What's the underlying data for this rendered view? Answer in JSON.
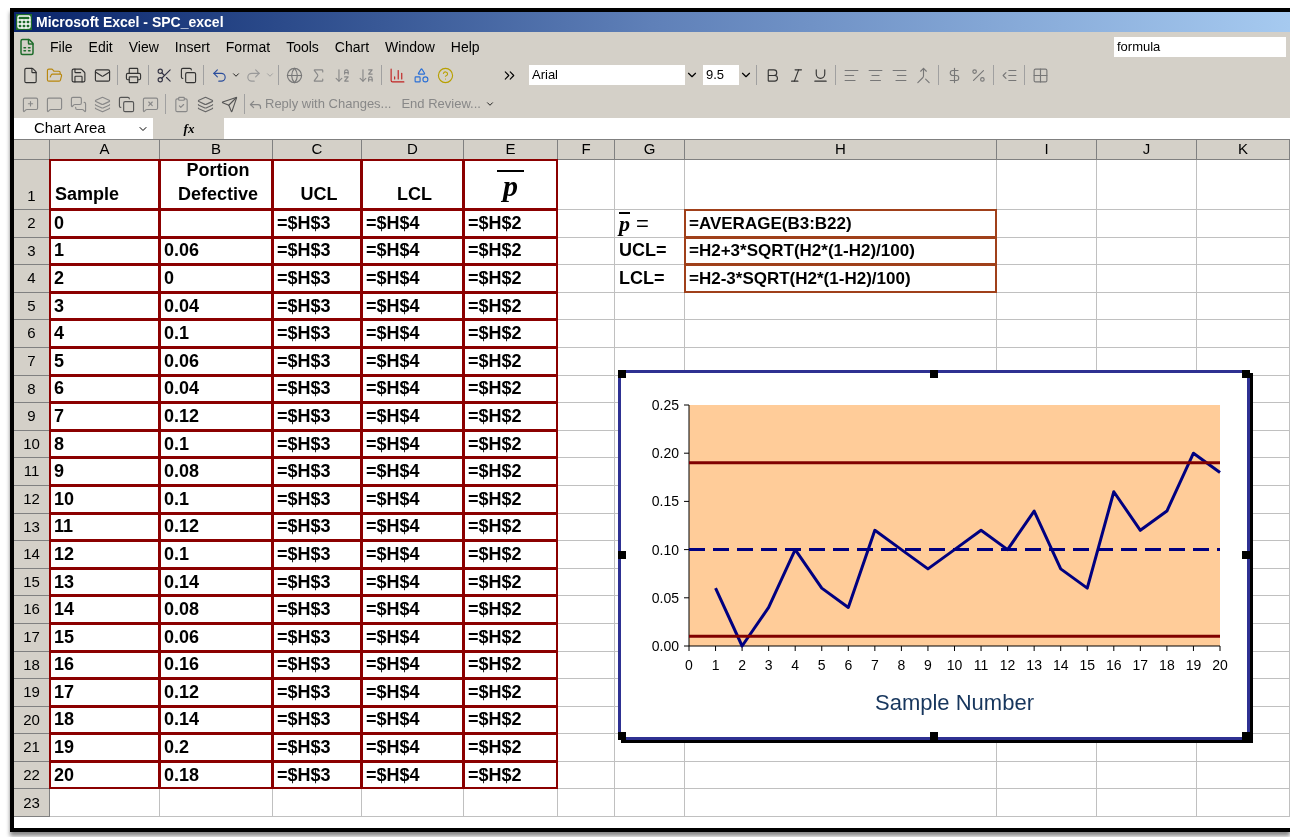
{
  "window": {
    "title": "Microsoft Excel - SPC_excel"
  },
  "menu": [
    {
      "label": "File"
    },
    {
      "label": "Edit"
    },
    {
      "label": "View"
    },
    {
      "label": "Insert"
    },
    {
      "label": "Format"
    },
    {
      "label": "Tools"
    },
    {
      "label": "Chart"
    },
    {
      "label": "Window"
    },
    {
      "label": "Help"
    }
  ],
  "help_box": {
    "value": "formula"
  },
  "font_box": {
    "name": "Arial",
    "size": "9.5"
  },
  "review_toolbar": [
    "Reply with Changes...",
    "End Review..."
  ],
  "name_box": {
    "value": "Chart Area"
  },
  "formula_label": "fx",
  "columns": [
    "A",
    "B",
    "C",
    "D",
    "E",
    "F",
    "G",
    "H",
    "I",
    "J",
    "K"
  ],
  "header_row": {
    "number": "1",
    "cells": [
      "Sample",
      "Portion Defective",
      "UCL",
      "LCL"
    ],
    "pbar_symbol": "p"
  },
  "rows": [
    {
      "number": "2",
      "sample": "0",
      "ucl": "=$H$3",
      "lcl": "=$H$4",
      "pbar": "=$H$2"
    },
    {
      "number": "3",
      "sample": "1",
      "portion": "0.06",
      "ucl": "=$H$3",
      "lcl": "=$H$4",
      "pbar": "=$H$2"
    },
    {
      "number": "4",
      "sample": "2",
      "portion": "0",
      "ucl": "=$H$3",
      "lcl": "=$H$4",
      "pbar": "=$H$2"
    },
    {
      "number": "5",
      "sample": "3",
      "portion": "0.04",
      "ucl": "=$H$3",
      "lcl": "=$H$4",
      "pbar": "=$H$2"
    },
    {
      "number": "6",
      "sample": "4",
      "portion": "0.1",
      "ucl": "=$H$3",
      "lcl": "=$H$4",
      "pbar": "=$H$2"
    },
    {
      "number": "7",
      "sample": "5",
      "portion": "0.06",
      "ucl": "=$H$3",
      "lcl": "=$H$4",
      "pbar": "=$H$2"
    },
    {
      "number": "8",
      "sample": "6",
      "portion": "0.04",
      "ucl": "=$H$3",
      "lcl": "=$H$4",
      "pbar": "=$H$2"
    },
    {
      "number": "9",
      "sample": "7",
      "portion": "0.12",
      "ucl": "=$H$3",
      "lcl": "=$H$4",
      "pbar": "=$H$2"
    },
    {
      "number": "10",
      "sample": "8",
      "portion": "0.1",
      "ucl": "=$H$3",
      "lcl": "=$H$4",
      "pbar": "=$H$2"
    },
    {
      "number": "11",
      "sample": "9",
      "portion": "0.08",
      "ucl": "=$H$3",
      "lcl": "=$H$4",
      "pbar": "=$H$2"
    },
    {
      "number": "12",
      "sample": "10",
      "portion": "0.1",
      "ucl": "=$H$3",
      "lcl": "=$H$4",
      "pbar": "=$H$2"
    },
    {
      "number": "13",
      "sample": "11",
      "portion": "0.12",
      "ucl": "=$H$3",
      "lcl": "=$H$4",
      "pbar": "=$H$2"
    },
    {
      "number": "14",
      "sample": "12",
      "portion": "0.1",
      "ucl": "=$H$3",
      "lcl": "=$H$4",
      "pbar": "=$H$2"
    },
    {
      "number": "15",
      "sample": "13",
      "portion": "0.14",
      "ucl": "=$H$3",
      "lcl": "=$H$4",
      "pbar": "=$H$2"
    },
    {
      "number": "16",
      "sample": "14",
      "portion": "0.08",
      "ucl": "=$H$3",
      "lcl": "=$H$4",
      "pbar": "=$H$2"
    },
    {
      "number": "17",
      "sample": "15",
      "portion": "0.06",
      "ucl": "=$H$3",
      "lcl": "=$H$4",
      "pbar": "=$H$2"
    },
    {
      "number": "18",
      "sample": "16",
      "portion": "0.16",
      "ucl": "=$H$3",
      "lcl": "=$H$4",
      "pbar": "=$H$2"
    },
    {
      "number": "19",
      "sample": "17",
      "portion": "0.12",
      "ucl": "=$H$3",
      "lcl": "=$H$4",
      "pbar": "=$H$2"
    },
    {
      "number": "20",
      "sample": "18",
      "portion": "0.14",
      "ucl": "=$H$3",
      "lcl": "=$H$4",
      "pbar": "=$H$2"
    },
    {
      "number": "21",
      "sample": "19",
      "portion": "0.2",
      "ucl": "=$H$3",
      "lcl": "=$H$4",
      "pbar": "=$H$2"
    },
    {
      "number": "22",
      "sample": "20",
      "portion": "0.18",
      "ucl": "=$H$3",
      "lcl": "=$H$4",
      "pbar": "=$H$2"
    }
  ],
  "last_row": "23",
  "formulas": [
    {
      "kind": "pbar",
      "symbol": "p",
      "label": "=",
      "formula": "=AVERAGE(B3:B22)"
    },
    {
      "kind": "text",
      "label": "UCL=",
      "formula": "=H2+3*SQRT(H2*(1-H2)/100)"
    },
    {
      "kind": "text",
      "label": "LCL=",
      "formula": "=H2-3*SQRT(H2*(1-H2)/100)"
    }
  ],
  "chart": {
    "selected": true,
    "chart_data": {
      "type": "line",
      "xlabel": "Sample Number",
      "x": [
        0,
        1,
        2,
        3,
        4,
        5,
        6,
        7,
        8,
        9,
        10,
        11,
        12,
        13,
        14,
        15,
        16,
        17,
        18,
        19,
        20
      ],
      "xlim": [
        0,
        20
      ],
      "ylim": [
        0,
        0.25
      ],
      "xticks": [
        0,
        1,
        2,
        3,
        4,
        5,
        6,
        7,
        8,
        9,
        10,
        11,
        12,
        13,
        14,
        15,
        16,
        17,
        18,
        19,
        20
      ],
      "yticks": [
        {
          "value": 0,
          "label": "0.00"
        },
        {
          "value": 0.05,
          "label": "0.05"
        },
        {
          "value": 0.1,
          "label": "0.10"
        },
        {
          "value": 0.15,
          "label": "0.15"
        },
        {
          "value": 0.2,
          "label": "0.20"
        },
        {
          "value": 0.25,
          "label": "0.25"
        }
      ],
      "series": [
        {
          "color": "#000080",
          "line_style": "solid",
          "values": [
            null,
            0.06,
            0,
            0.04,
            0.1,
            0.06,
            0.04,
            0.12,
            0.1,
            0.08,
            0.1,
            0.12,
            0.1,
            0.14,
            0.08,
            0.06,
            0.16,
            0.12,
            0.14,
            0.2,
            0.18
          ]
        },
        {
          "color": "#800000",
          "line_style": "solid",
          "values": [
            0.19,
            0.19,
            0.19,
            0.19,
            0.19,
            0.19,
            0.19,
            0.19,
            0.19,
            0.19,
            0.19,
            0.19,
            0.19,
            0.19,
            0.19,
            0.19,
            0.19,
            0.19,
            0.19,
            0.19,
            0.19
          ]
        },
        {
          "color": "#800000",
          "line_style": "solid",
          "values": [
            0.01,
            0.01,
            0.01,
            0.01,
            0.01,
            0.01,
            0.01,
            0.01,
            0.01,
            0.01,
            0.01,
            0.01,
            0.01,
            0.01,
            0.01,
            0.01,
            0.01,
            0.01,
            0.01,
            0.01,
            0.01
          ]
        },
        {
          "color": "#000080",
          "line_style": "dashed",
          "values": [
            0.1,
            0.1,
            0.1,
            0.1,
            0.1,
            0.1,
            0.1,
            0.1,
            0.1,
            0.1,
            0.1,
            0.1,
            0.1,
            0.1,
            0.1,
            0.1,
            0.1,
            0.1,
            0.1,
            0.1,
            0.1
          ]
        }
      ]
    }
  }
}
